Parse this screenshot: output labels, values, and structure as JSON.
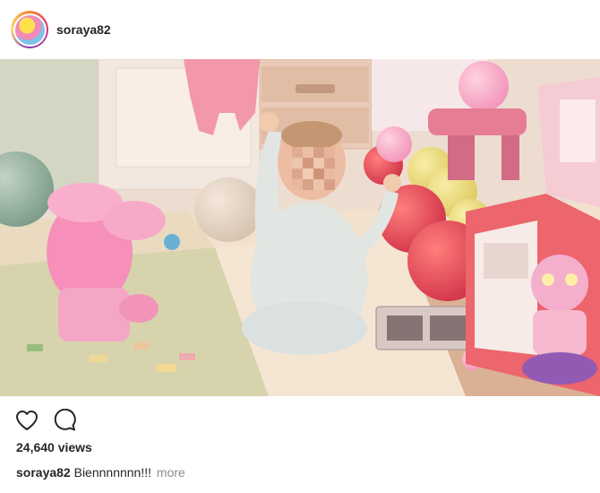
{
  "post": {
    "username": "soraya82",
    "views": "24,640 views",
    "caption_user": "soraya82",
    "caption_text": "Biennnnnnn!!!",
    "more_label": "more"
  },
  "icons": {
    "like": "heart-outline-icon",
    "comment": "speech-bubble-icon"
  },
  "colors": {
    "text": "#262626",
    "muted": "#8e8e8e",
    "border": "#efefef"
  }
}
